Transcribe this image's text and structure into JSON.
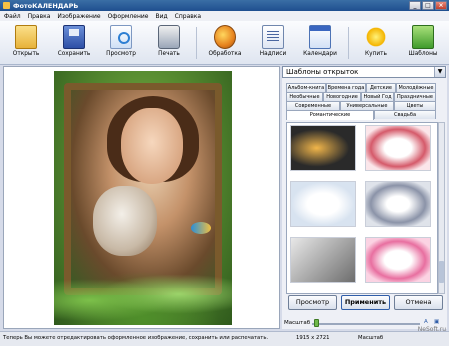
{
  "window": {
    "title": "ФотоКАЛЕНДАРЬ"
  },
  "menu": [
    "Файл",
    "Правка",
    "Изображение",
    "Оформление",
    "Вид",
    "Справка"
  ],
  "toolbar": {
    "open": "Открыть",
    "save": "Сохранить",
    "preview": "Просмотр",
    "print": "Печать",
    "process": "Обработка",
    "captions": "Надписи",
    "calendars": "Календари",
    "buy": "Купить",
    "templates": "Шаблоны"
  },
  "panel": {
    "title": "Шаблоны открыток",
    "tabs_row1": [
      "Альбом-книга",
      "Времена года",
      "Детские",
      "Молодёжные"
    ],
    "tabs_row2": [
      "Необычные",
      "Новогодние",
      "Новый Год",
      "Праздничные"
    ],
    "tabs_row3": [
      "Современные",
      "Универсальные",
      "Цветы"
    ],
    "tabs_row4": [
      "Романтические",
      "Свадьба"
    ],
    "active_tab": "Романтические"
  },
  "buttons": {
    "preview": "Просмотр",
    "apply": "Применить",
    "cancel": "Отмена"
  },
  "zoom": {
    "label": "Масштаб",
    "value": 0.05
  },
  "status": {
    "hint": "Теперь Вы можете отредактировать оформленное изображение, сохранить или распечатать.",
    "dims": "1915 x 2721",
    "zoom": "Масштаб",
    "watermark": "NeSoft.ru"
  }
}
